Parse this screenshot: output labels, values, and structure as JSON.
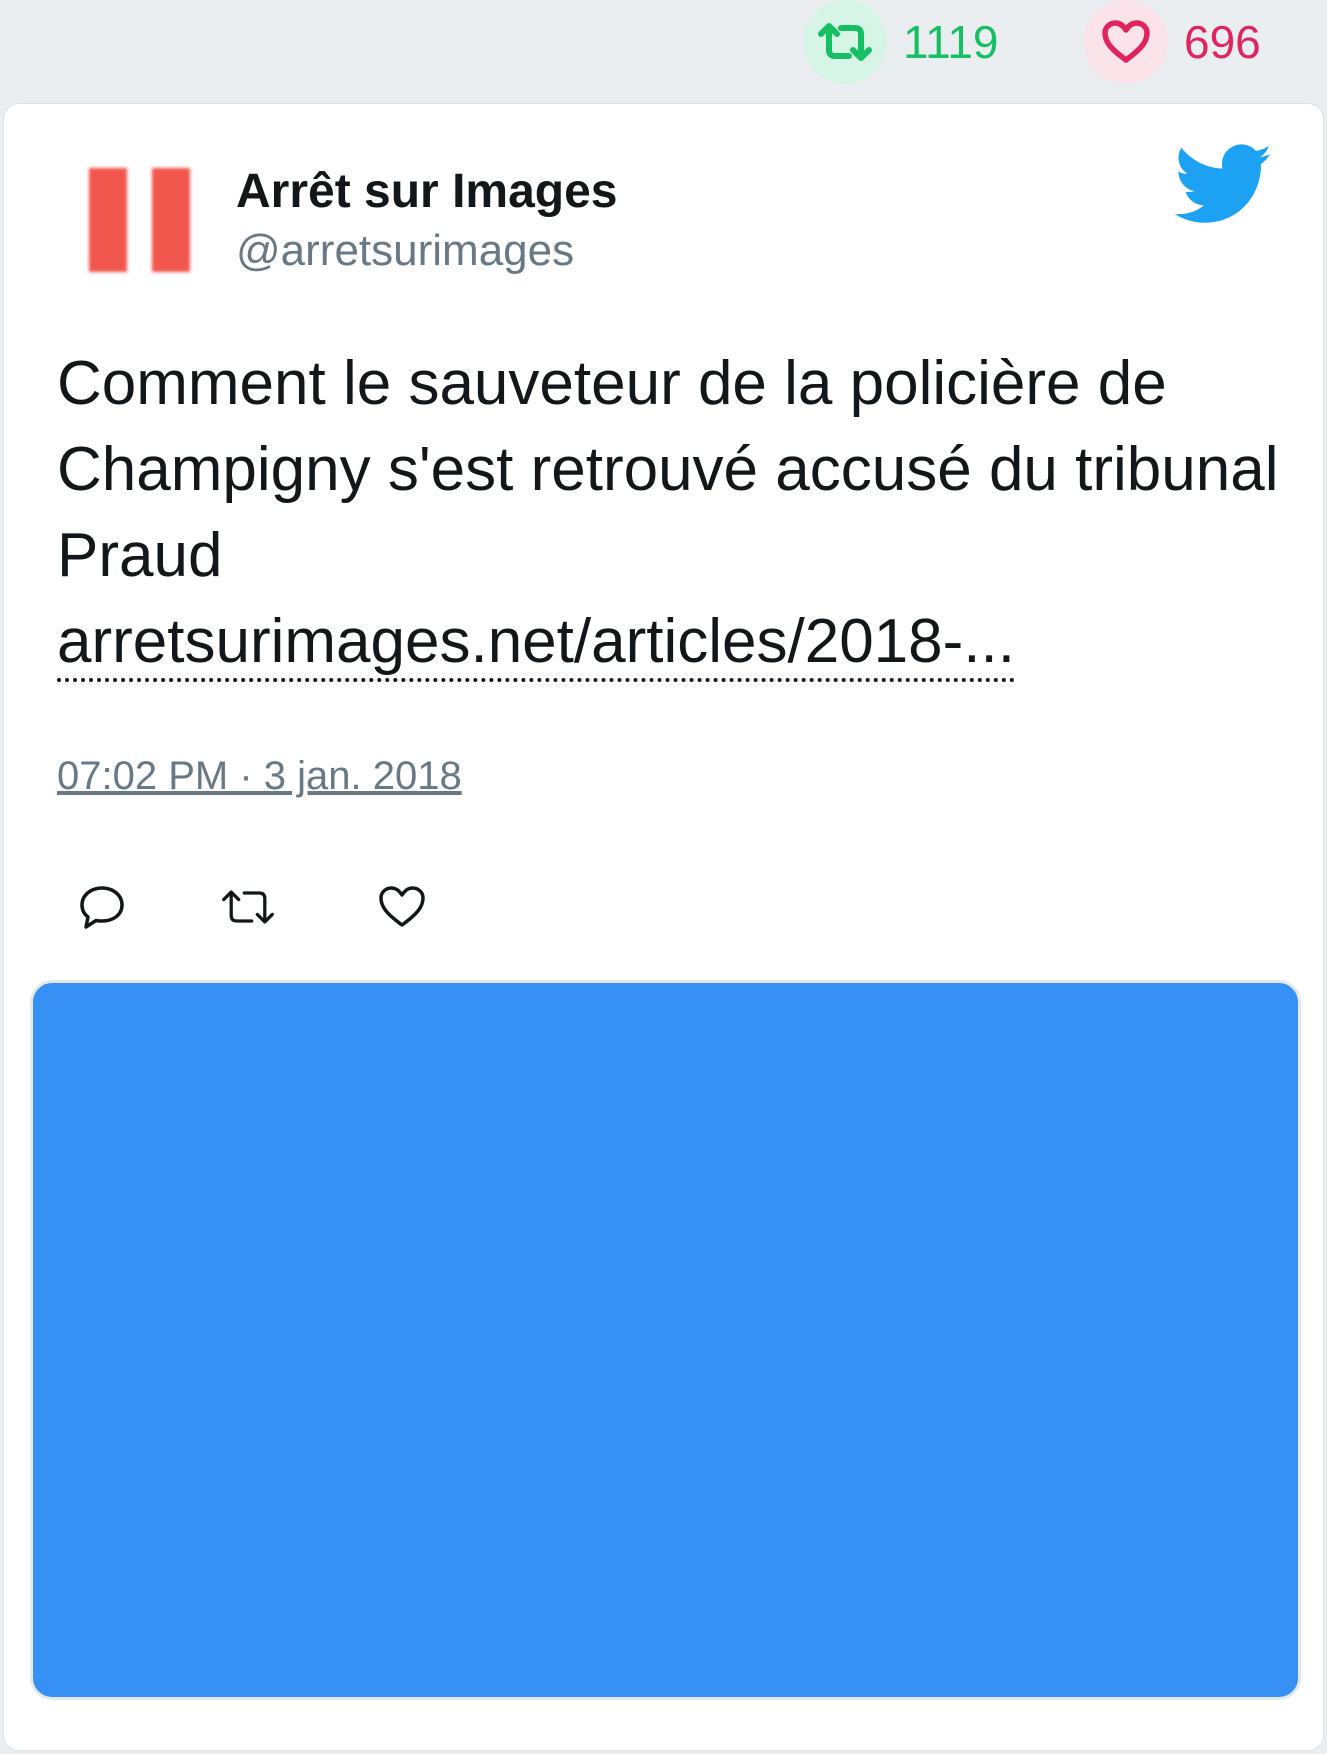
{
  "stats": {
    "retweets": "1119",
    "likes": "696"
  },
  "colors": {
    "retweet": "#17bf63",
    "like": "#e0245e",
    "twitter_blue": "#1da1f2",
    "media_bg": "#3791f4"
  },
  "tweet": {
    "author_name": "Arrêt sur Images",
    "author_handle": "@arretsurimages",
    "text": "Comment le sauveteur de la policière de Champigny s'est retrouvé accusé du tribunal Praud",
    "link_text": "arretsurimages.net/articles/2018-...",
    "timestamp": "07:02 PM · 3 jan. 2018"
  },
  "icons": {
    "retweet_stat": "retweet-icon",
    "like_stat": "heart-icon",
    "brand": "twitter-bird-icon",
    "reply_action": "reply-icon",
    "retweet_action": "retweet-icon",
    "like_action": "heart-icon"
  }
}
